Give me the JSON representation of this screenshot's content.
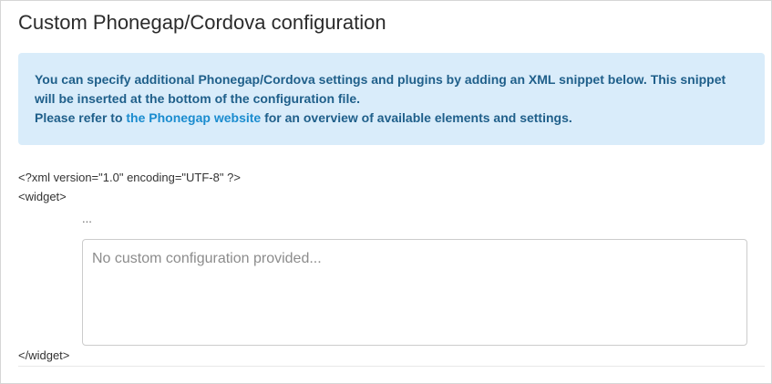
{
  "section": {
    "title": "Custom Phonegap/Cordova configuration"
  },
  "info": {
    "line1": "You can specify additional Phonegap/Cordova settings and plugins by adding an XML snippet below. This snippet will be inserted at the bottom of the configuration file.",
    "line2_prefix": "Please refer to ",
    "link_text": "the Phonegap website",
    "line2_suffix": " for an overview of available elements and settings."
  },
  "xml": {
    "declaration": "<?xml version=\"1.0\" encoding=\"UTF-8\" ?>",
    "widget_open": "<widget>",
    "ellipsis": "...",
    "widget_close": "</widget>"
  },
  "config_input": {
    "value": "",
    "placeholder": "No custom configuration provided..."
  },
  "colors": {
    "info_background": "#d9ecfa",
    "info_text": "#1f5f8a",
    "link": "#1a8ccf"
  }
}
